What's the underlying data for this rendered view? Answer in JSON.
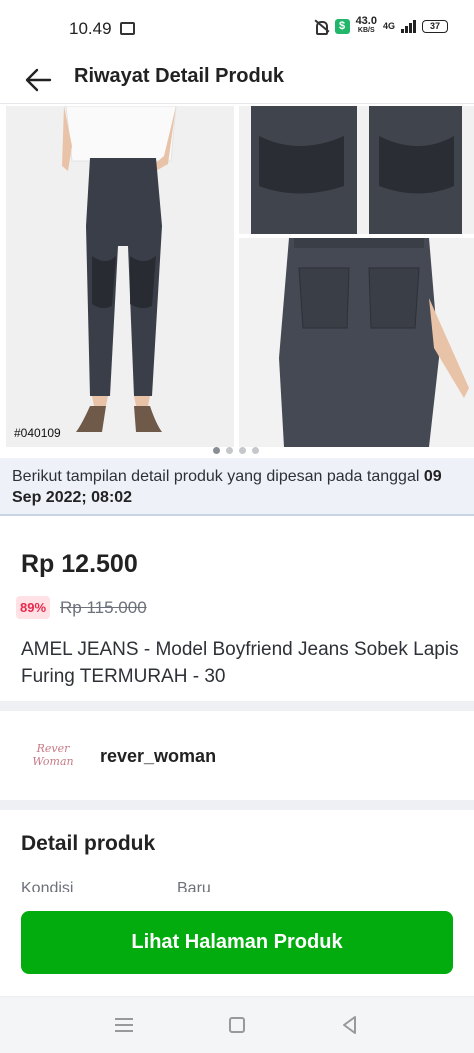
{
  "status_bar": {
    "time": "10.49",
    "speed_value": "43.0",
    "speed_unit": "KB/S",
    "network": "4G",
    "battery": "37"
  },
  "header": {
    "title": "Riwayat Detail Produk",
    "back_icon": "arrow-left-icon"
  },
  "gallery": {
    "photo_tag": "#040109",
    "dot_count": 4,
    "active_dot": 0
  },
  "info_banner": {
    "text": "Berikut tampilan detail produk yang dipesan pada tanggal ",
    "date": "09 Sep 2022; 08:02"
  },
  "product": {
    "price": "Rp 12.500",
    "discount": "89%",
    "original_price": "Rp 115.000",
    "name": "AMEL JEANS - Model Boyfriend Jeans Sobek Lapis Furing TERMURAH - 30"
  },
  "seller": {
    "logo_text": "Rever Woman",
    "name": "rever_woman"
  },
  "detail": {
    "title": "Detail produk",
    "condition_label": "Kondisi",
    "condition_value": "Baru"
  },
  "cta": {
    "label": "Lihat Halaman Produk"
  },
  "colors": {
    "accent_green": "#03ac0e",
    "discount_red": "#e82a4b",
    "discount_bg": "#ffe1e6",
    "banner_bg": "#eef2f8"
  }
}
